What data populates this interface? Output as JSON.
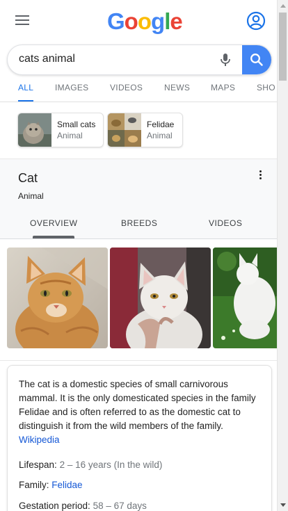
{
  "header": {
    "logo_letters": [
      {
        "ch": "G",
        "color": "#4285f4"
      },
      {
        "ch": "o",
        "color": "#ea4335"
      },
      {
        "ch": "o",
        "color": "#fbbc05"
      },
      {
        "ch": "g",
        "color": "#4285f4"
      },
      {
        "ch": "l",
        "color": "#34a853"
      },
      {
        "ch": "e",
        "color": "#ea4335"
      }
    ],
    "menu_icon": "menu-icon",
    "account_icon": "account-circle-icon"
  },
  "search": {
    "query": "cats animal",
    "mic_icon": "microphone-icon",
    "search_icon": "search-icon"
  },
  "tabs": [
    {
      "label": "ALL",
      "active": true
    },
    {
      "label": "IMAGES",
      "active": false
    },
    {
      "label": "VIDEOS",
      "active": false
    },
    {
      "label": "NEWS",
      "active": false
    },
    {
      "label": "MAPS",
      "active": false
    },
    {
      "label": "SHO",
      "active": false
    }
  ],
  "related": [
    {
      "name": "Small cats",
      "type": "Animal"
    },
    {
      "name": "Felidae",
      "type": "Animal"
    }
  ],
  "knowledge_panel": {
    "title": "Cat",
    "subtitle": "Animal",
    "tabs": [
      {
        "label": "OVERVIEW",
        "active": true
      },
      {
        "label": "BREEDS",
        "active": false
      },
      {
        "label": "VIDEOS",
        "active": false
      }
    ],
    "images": [
      "orange-tabby-cat-photo",
      "white-cat-photo",
      "white-cat-on-grass-photo"
    ]
  },
  "description": {
    "text": "The cat is a domestic species of small carnivorous mammal. It is the only domesticated species in the family Felidae and is often referred to as the domestic cat to distinguish it from the wild members of the family.",
    "source": "Wikipedia",
    "facts": [
      {
        "label": "Lifespan:",
        "value": "2 – 16 years (In the wild)",
        "is_link": false
      },
      {
        "label": "Family:",
        "value": "Felidae",
        "is_link": true
      },
      {
        "label": "Gestation period:",
        "value": "58 – 67 days",
        "is_link": false
      }
    ]
  },
  "colors": {
    "accent": "#1a73e8",
    "search_button": "#4285f4",
    "link": "#1558d6"
  }
}
